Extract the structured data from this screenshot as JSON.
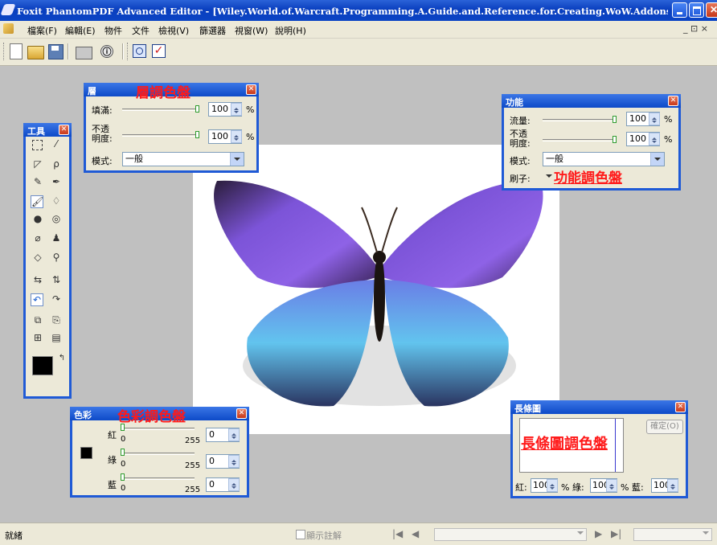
{
  "window": {
    "title": "Foxit PhantomPDF Advanced Editor - [Wiley.World.of.Warcraft.Programming.A.Guide.and.Reference.for.Creating.WoW.Addons.Second.Edition : 影..."
  },
  "menu": {
    "items": [
      "檔案(F)",
      "編輯(E)",
      "物件",
      "文件",
      "檢視(V)",
      "篩選器",
      "視窗(W)",
      "說明(H)"
    ],
    "mdi_controls": "_ ⊡ ×"
  },
  "toolbar": {
    "icons": [
      "new-document-icon",
      "open-folder-icon",
      "save-icon",
      "print-icon",
      "info-icon",
      "stop-icon",
      "checkmark-icon"
    ],
    "info_glyph": "ⓘ",
    "check_glyph": "✓"
  },
  "layers_panel": {
    "title": "層",
    "annotation": "層調色盤",
    "fill_label": "填滿:",
    "fill_value": "100",
    "opacity_label": "不透\n明度:",
    "opacity_value": "100",
    "percent": "%",
    "mode_label": "模式:",
    "mode_value": "一般"
  },
  "function_panel": {
    "title": "功能",
    "flow_label": "流量:",
    "flow_value": "100",
    "opacity_label": "不透\n明度:",
    "opacity_value": "100",
    "percent": "%",
    "mode_label": "模式:",
    "mode_value": "一般",
    "brush_label": "刷子:",
    "annotation": "功能調色盤"
  },
  "tools_panel": {
    "title": "工具",
    "icons": [
      "marquee-icon",
      "magic-wand-icon",
      "lasso-polygon-icon",
      "lasso-icon",
      "pen-icon",
      "brush-pen-icon",
      "paintbrush-icon",
      "paint-bucket-icon",
      "blur-icon",
      "smudge-icon",
      "healing-icon",
      "clone-stamp-icon",
      "eraser-icon",
      "zoom-icon",
      "swap-icon",
      "flip-icon",
      "undo-icon",
      "redo-icon",
      "copy-icon",
      "paste-icon",
      "import-icon",
      "save-small-icon"
    ]
  },
  "color_panel": {
    "title": "色彩",
    "annotation": "色彩調色盤",
    "red_label": "紅",
    "green_label": "綠",
    "blue_label": "藍",
    "min": "0",
    "max": "255",
    "red_value": "0",
    "green_value": "0",
    "blue_value": "0"
  },
  "histogram_panel": {
    "title": "長條圖",
    "ok_button": "確定(O)",
    "annotation": "長條圖調色盤",
    "red_label": "紅:",
    "red_value": "100",
    "green_label": "% 綠:",
    "green_value": "100",
    "blue_label": "% 藍:",
    "blue_value": "100"
  },
  "status": {
    "text": "就緒",
    "show_comments": "顯示註解"
  },
  "colors": {
    "accent": "#1f5ad6",
    "annotation_red": "#ff1a1a",
    "workspace": "#c0c0c0"
  }
}
